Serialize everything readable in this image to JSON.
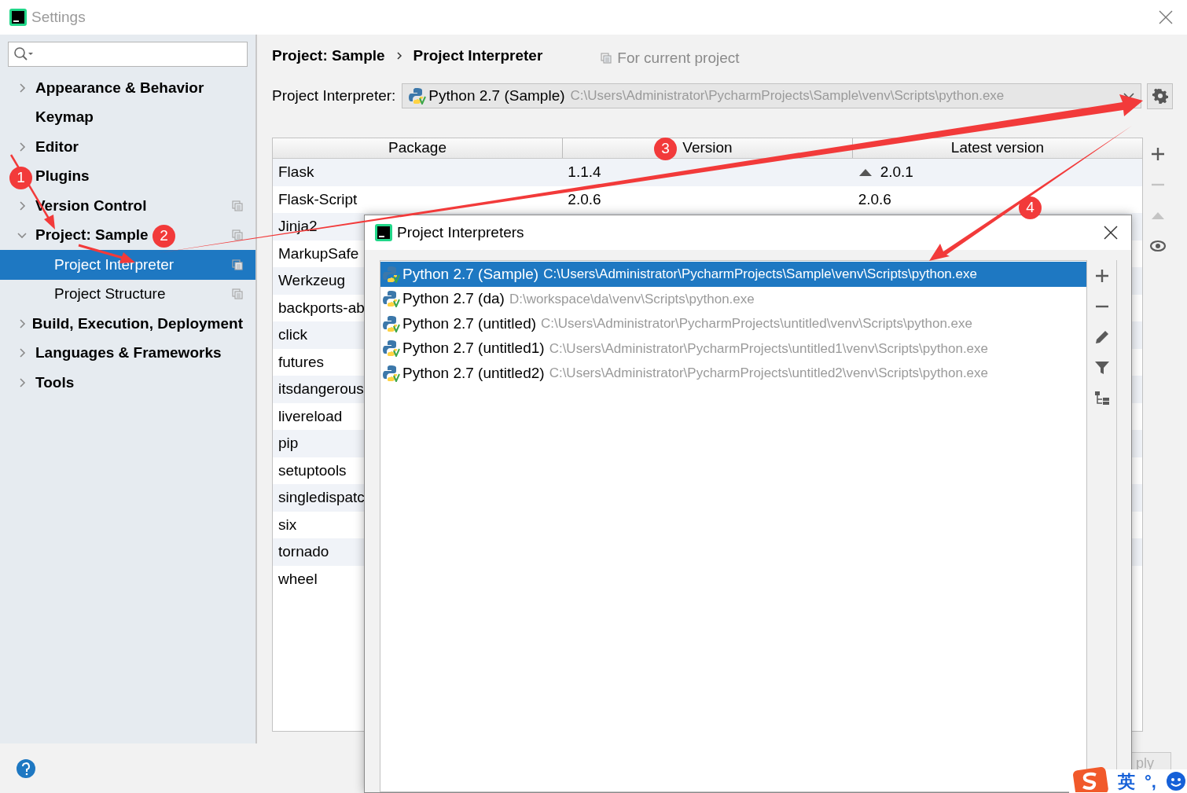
{
  "window": {
    "title": "Settings"
  },
  "sidebar": {
    "items": [
      {
        "label": "Appearance & Behavior",
        "kind": "group",
        "expanded": false,
        "project_scoped": false
      },
      {
        "label": "Keymap",
        "kind": "leaf",
        "project_scoped": false
      },
      {
        "label": "Editor",
        "kind": "group",
        "expanded": false,
        "project_scoped": false
      },
      {
        "label": "Plugins",
        "kind": "leaf",
        "project_scoped": false
      },
      {
        "label": "Version Control",
        "kind": "group",
        "expanded": false,
        "project_scoped": true
      },
      {
        "label": "Project: Sample",
        "kind": "group",
        "expanded": true,
        "project_scoped": true,
        "children": [
          {
            "label": "Project Interpreter",
            "selected": true,
            "project_scoped": true
          },
          {
            "label": "Project Structure",
            "selected": false,
            "project_scoped": true
          }
        ]
      },
      {
        "label": "Build, Execution, Deployment",
        "kind": "group",
        "expanded": false,
        "project_scoped": false
      },
      {
        "label": "Languages & Frameworks",
        "kind": "group",
        "expanded": false,
        "project_scoped": false
      },
      {
        "label": "Tools",
        "kind": "group",
        "expanded": false,
        "project_scoped": false
      }
    ]
  },
  "breadcrumb": [
    "Project: Sample",
    "Project Interpreter"
  ],
  "scope_hint": "For current project",
  "interpreter": {
    "label": "Project Interpreter:",
    "name": "Python 2.7 (Sample)",
    "path": "C:\\Users\\Administrator\\PycharmProjects\\Sample\\venv\\Scripts\\python.exe"
  },
  "packages": {
    "columns": [
      "Package",
      "Version",
      "Latest version"
    ],
    "rows": [
      {
        "package": "Flask",
        "version": "1.1.4",
        "latest": "2.0.1",
        "upgrade": true
      },
      {
        "package": "Flask-Script",
        "version": "2.0.6",
        "latest": "2.0.6",
        "upgrade": false
      },
      {
        "package": "Jinja2"
      },
      {
        "package": "MarkupSafe"
      },
      {
        "package": "Werkzeug"
      },
      {
        "package": "backports-ab"
      },
      {
        "package": "click"
      },
      {
        "package": "futures"
      },
      {
        "package": "itsdangerous"
      },
      {
        "package": "livereload"
      },
      {
        "package": "pip"
      },
      {
        "package": "setuptools"
      },
      {
        "package": "singledispatc"
      },
      {
        "package": "six"
      },
      {
        "package": "tornado"
      },
      {
        "package": "wheel"
      }
    ],
    "tools": [
      {
        "kind": "add",
        "disabled": false
      },
      {
        "kind": "remove",
        "disabled": true
      },
      {
        "kind": "upgrade",
        "disabled": true
      },
      {
        "kind": "show",
        "disabled": false
      }
    ]
  },
  "dialog": {
    "title": "Project Interpreters",
    "interpreters": [
      {
        "name": "Python 2.7 (Sample)",
        "path": "C:\\Users\\Administrator\\PycharmProjects\\Sample\\venv\\Scripts\\python.exe",
        "selected": true
      },
      {
        "name": "Python 2.7 (da)",
        "path": "D:\\workspace\\da\\venv\\Scripts\\python.exe",
        "selected": false
      },
      {
        "name": "Python 2.7 (untitled)",
        "path": "C:\\Users\\Administrator\\PycharmProjects\\untitled\\venv\\Scripts\\python.exe",
        "selected": false
      },
      {
        "name": "Python 2.7 (untitled1)",
        "path": "C:\\Users\\Administrator\\PycharmProjects\\untitled1\\venv\\Scripts\\python.exe",
        "selected": false
      },
      {
        "name": "Python 2.7 (untitled2)",
        "path": "C:\\Users\\Administrator\\PycharmProjects\\untitled2\\venv\\Scripts\\python.exe",
        "selected": false
      }
    ],
    "tools": [
      {
        "kind": "add"
      },
      {
        "kind": "remove"
      },
      {
        "kind": "edit"
      },
      {
        "kind": "filter"
      },
      {
        "kind": "paths"
      }
    ]
  },
  "apply_button": {
    "label": "ply",
    "disabled": true
  },
  "ime": {
    "items": [
      "英",
      "°,"
    ]
  },
  "annotations": [
    {
      "label": "1"
    },
    {
      "label": "2"
    },
    {
      "label": "3"
    },
    {
      "label": "4"
    }
  ]
}
